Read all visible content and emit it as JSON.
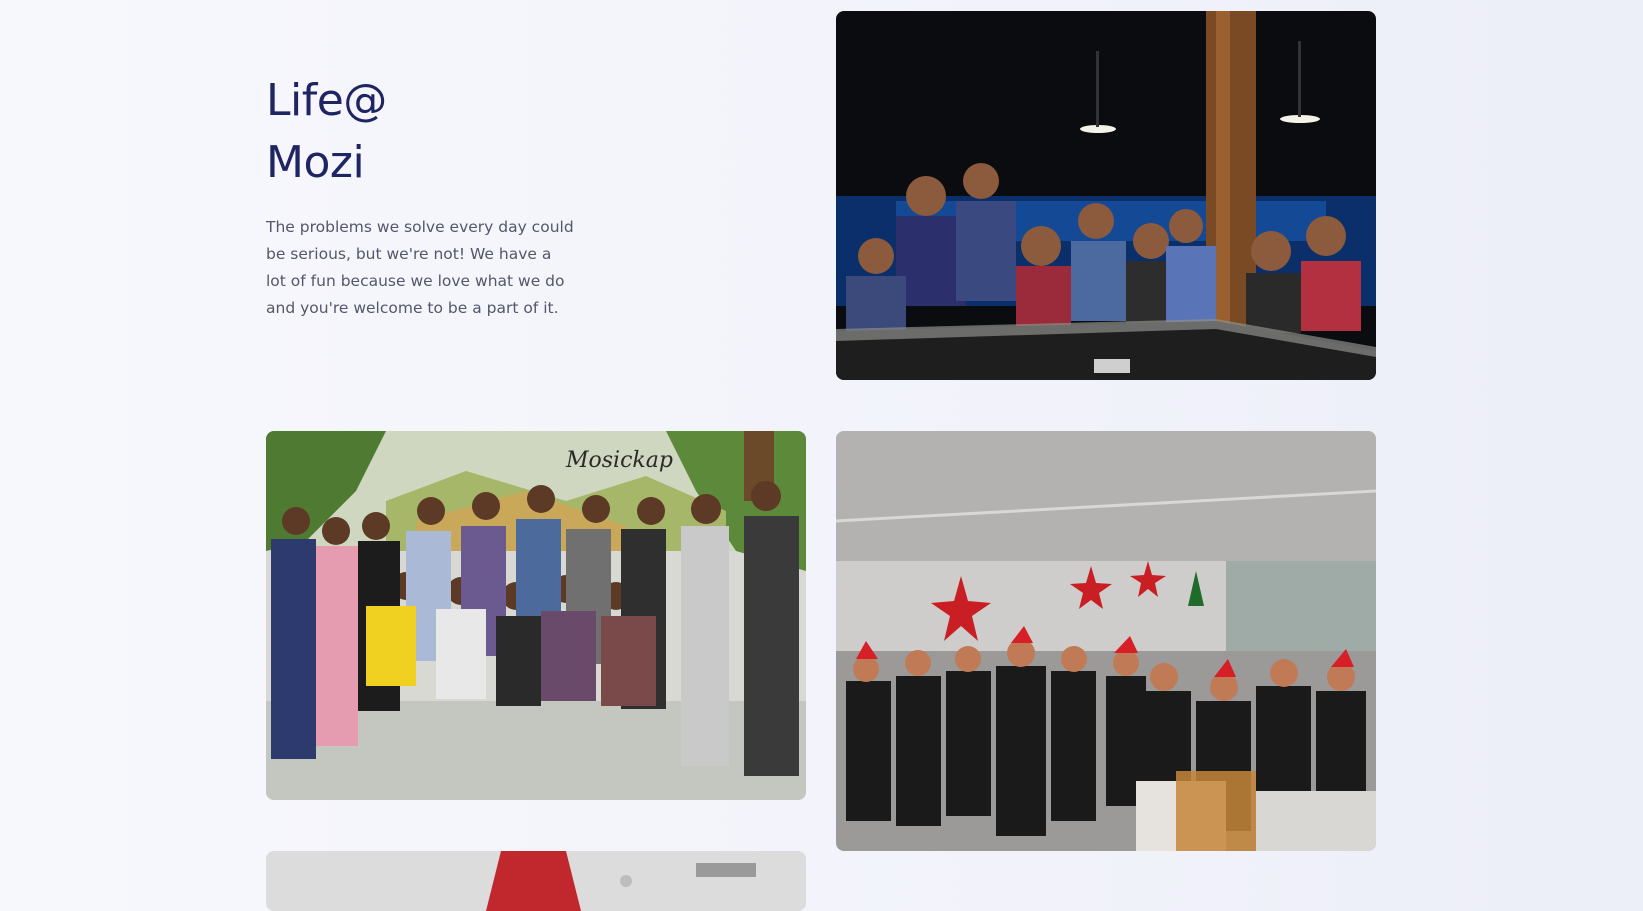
{
  "section": {
    "title_line1": "Life@",
    "title_line2": "Mozi",
    "description": "The problems we solve every day could be serious, but we're not! We have a lot of fun because we love what we do and you're welcome to be a part of it."
  },
  "photos": [
    {
      "name": "team-night-photo",
      "icon": "photo-team-poolside-night"
    },
    {
      "name": "team-group-photo",
      "icon": "photo-team-mural-group"
    },
    {
      "name": "office-christmas-photo",
      "icon": "photo-office-celebration"
    },
    {
      "name": "office-ceiling-photo",
      "icon": "photo-office-partial"
    }
  ],
  "colors": {
    "title": "#1f2463",
    "text": "#54576a",
    "background": "#f3f4fb"
  }
}
